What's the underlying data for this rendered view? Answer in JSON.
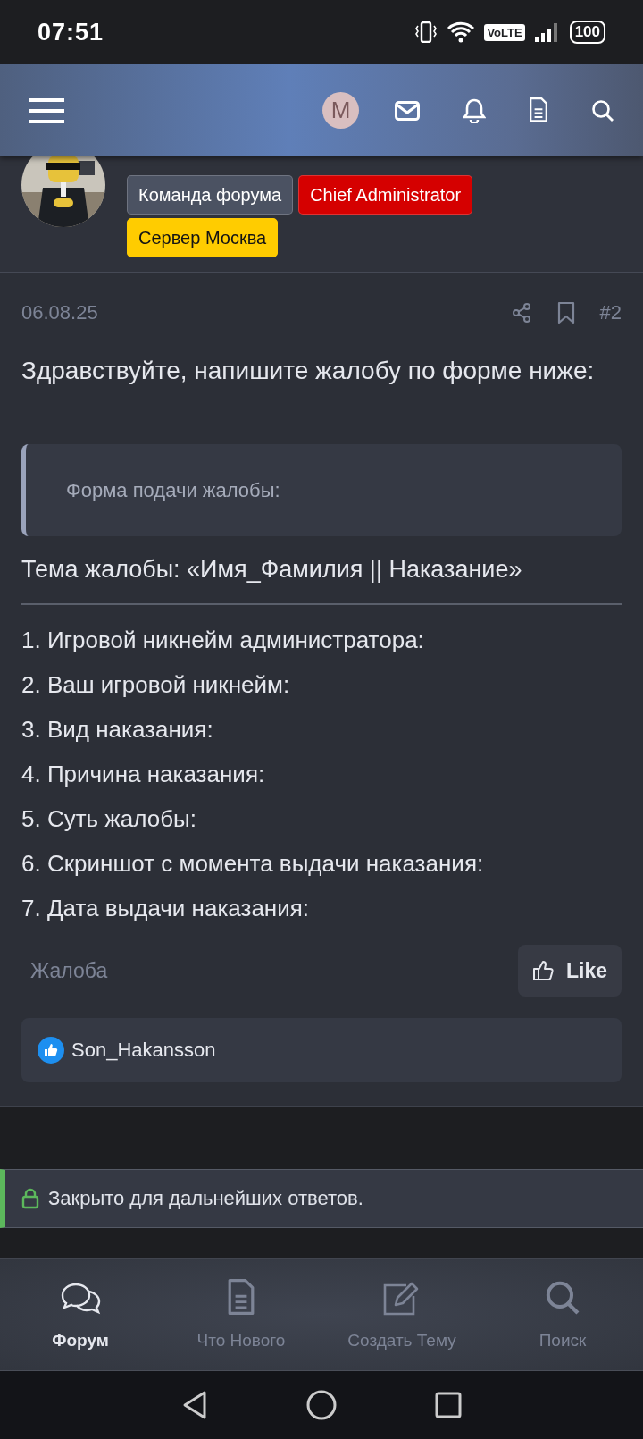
{
  "status_bar": {
    "time": "07:51",
    "network": "VoLTE",
    "battery": "100"
  },
  "top_bar": {
    "avatar_letter": "M"
  },
  "post": {
    "badges": [
      {
        "label": "Команда форума",
        "color": "#4b5262"
      },
      {
        "label": "Chief Administrator",
        "color": "#d50000"
      },
      {
        "label": "Сервер Москва",
        "color": "#ffcc00"
      }
    ],
    "date": "06.08.25",
    "number": "#2",
    "greeting": "Здравствуйте, напишите жалобу по форме ниже:",
    "quote": "Форма подачи жалобы:",
    "subject": "Тема жалобы: «Имя_Фамилия || Наказание»",
    "items": [
      "1. Игровой никнейм администратора:",
      "2. Ваш игровой никнейм:",
      "3. Вид наказания:",
      "4. Причина наказания:",
      "5. Суть жалобы:",
      "6. Скриншот с момента выдачи наказания:",
      "7. Дата выдачи наказания:"
    ],
    "report_link": "Жалоба",
    "like_button": "Like",
    "liked_by": "Son_Hakansson"
  },
  "closed_notice": "Закрыто для дальнейших ответов.",
  "bottom_nav": [
    {
      "label": "Форум",
      "selected": true
    },
    {
      "label": "Что Нового",
      "selected": false
    },
    {
      "label": "Создать Тему",
      "selected": false
    },
    {
      "label": "Поиск",
      "selected": false
    }
  ]
}
